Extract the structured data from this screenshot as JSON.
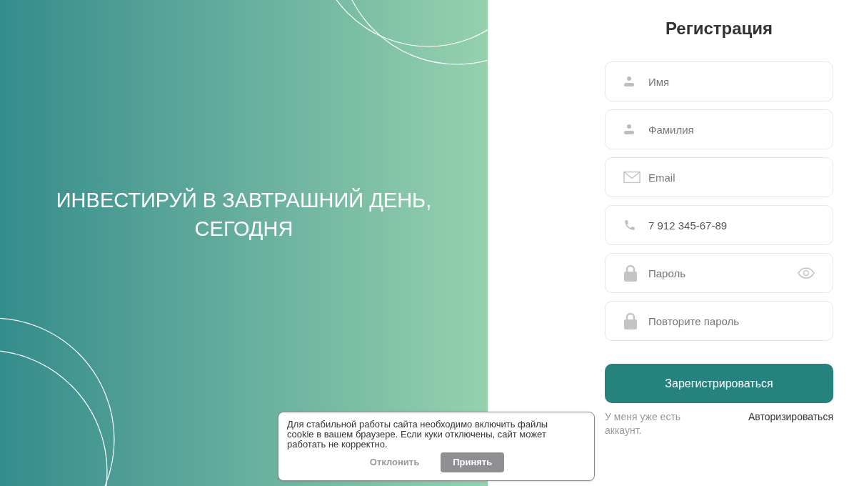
{
  "hero": {
    "headline": "ИНВЕСТИРУЙ В ЗАВТРАШНИЙ ДЕНЬ, СЕГОДНЯ"
  },
  "form": {
    "title": "Регистрация",
    "fields": [
      {
        "kind": "name",
        "placeholder": "Имя"
      },
      {
        "kind": "name",
        "placeholder": "Фамилия"
      },
      {
        "kind": "email",
        "placeholder": "Email"
      },
      {
        "kind": "phone",
        "value": "7 912 345-67-89"
      },
      {
        "kind": "password",
        "placeholder": "Пароль",
        "reveal_toggle": true
      },
      {
        "kind": "password",
        "placeholder": "Повторите пароль",
        "reveal_toggle": false
      }
    ],
    "submit": "Зарегистрироваться",
    "login_prompt": "У меня уже есть аккаунт.",
    "login_link": "Авторизироваться"
  },
  "cookie_banner": {
    "text": "Для стабильной работы сайта необходимо включить файлы cookie в вашем браузере. Если куки отключены, сайт может работать не корректно.",
    "decline": "Отклонить",
    "accept": "Принять"
  }
}
